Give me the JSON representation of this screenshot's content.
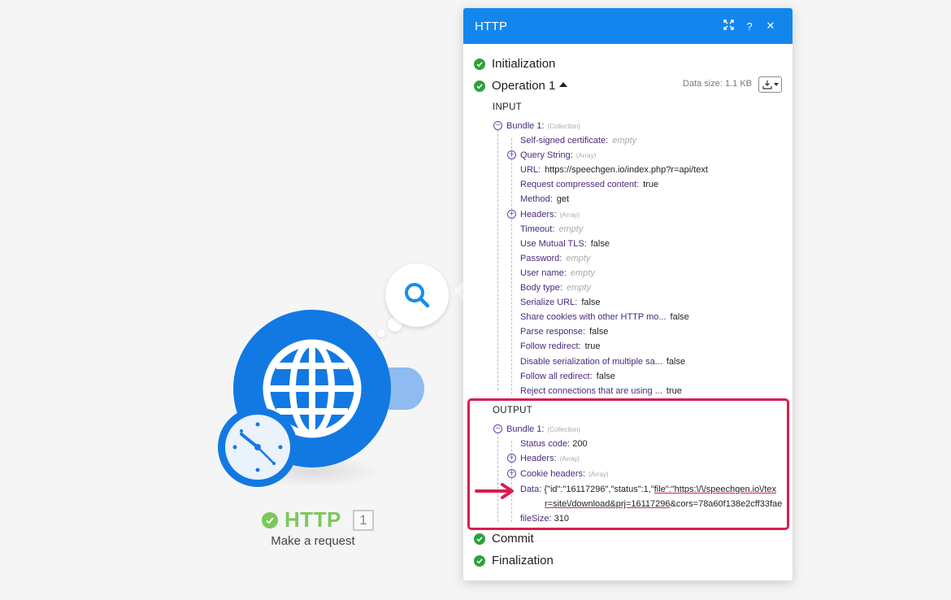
{
  "module": {
    "title": "HTTP",
    "count": "1",
    "subtitle": "Make a request"
  },
  "panel": {
    "title": "HTTP",
    "icons": [
      "expand-icon",
      "help-icon",
      "close-icon"
    ],
    "help_glyph": "?",
    "close_glyph": "✕"
  },
  "sections": {
    "initialization": "Initialization",
    "operation": "Operation 1",
    "data_size": "Data size: 1.1 KB",
    "commit": "Commit",
    "finalization": "Finalization"
  },
  "input": {
    "label": "INPUT",
    "bundle_key": "Bundle 1:",
    "bundle_meta": "(Collection)",
    "fields": [
      {
        "key": "Self-signed certificate:",
        "value": "empty",
        "is_empty": true
      },
      {
        "key": "Query String:",
        "value": "(Array)",
        "is_array": true
      },
      {
        "key": "URL:",
        "value": "https://speechgen.io/index.php?r=api/text"
      },
      {
        "key": "Request compressed content:",
        "value": "true"
      },
      {
        "key": "Method:",
        "value": "get"
      },
      {
        "key": "Headers:",
        "value": "(Array)",
        "is_array": true
      },
      {
        "key": "Timeout:",
        "value": "empty",
        "is_empty": true
      },
      {
        "key": "Use Mutual TLS:",
        "value": "false"
      },
      {
        "key": "Password:",
        "value": "empty",
        "is_empty": true
      },
      {
        "key": "User name:",
        "value": "empty",
        "is_empty": true
      },
      {
        "key": "Body type:",
        "value": "empty",
        "is_empty": true
      },
      {
        "key": "Serialize URL:",
        "value": "false"
      },
      {
        "key": "Share cookies with other HTTP mo...",
        "value": "false"
      },
      {
        "key": "Parse response:",
        "value": "false"
      },
      {
        "key": "Follow redirect:",
        "value": "true"
      },
      {
        "key": "Disable serialization of multiple sa...",
        "value": "false"
      },
      {
        "key": "Follow all redirect:",
        "value": "false"
      },
      {
        "key": "Reject connections that are using ...",
        "value": "true"
      }
    ]
  },
  "output": {
    "label": "OUTPUT",
    "bundle_key": "Bundle 1:",
    "bundle_meta": "(Collection)",
    "status_key": "Status code:",
    "status_value": "200",
    "headers_key": "Headers:",
    "headers_meta": "(Array)",
    "cookie_key": "Cookie headers:",
    "cookie_meta": "(Array)",
    "data_key": "Data:",
    "data_line1_a": "{\"id\":\"16117296\",\"status\":1,\"",
    "data_line1_b": "file\":\"https:\\/\\/speechgen.io\\/tex",
    "data_line2_a": "r=site\\/download&prj=16117296",
    "data_line2_b": "&cors=78a60f138e2cff33fae",
    "filesize_key": "fileSize:",
    "filesize_value": "310"
  },
  "colors": {
    "header": "#1386ee",
    "success": "#2ea13c",
    "highlight": "#d6204f",
    "module_blue": "#1279e3"
  }
}
